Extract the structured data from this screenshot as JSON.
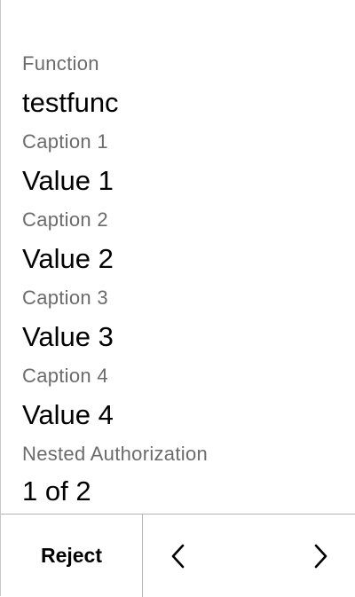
{
  "fields": [
    {
      "caption": "Function",
      "value": "testfunc"
    },
    {
      "caption": "Caption 1",
      "value": "Value 1"
    },
    {
      "caption": "Caption 2",
      "value": "Value 2"
    },
    {
      "caption": "Caption 3",
      "value": "Value 3"
    },
    {
      "caption": "Caption 4",
      "value": "Value 4"
    },
    {
      "caption": "Nested Authorization",
      "value": ""
    }
  ],
  "pagination": {
    "label": "1 of 2"
  },
  "footer": {
    "reject_label": "Reject",
    "prev_icon": "chevron-left-icon",
    "next_icon": "chevron-right-icon"
  },
  "colors": {
    "caption": "#6b6b6b",
    "value": "#000000",
    "divider": "#b5b5b5",
    "background": "#ffffff"
  }
}
